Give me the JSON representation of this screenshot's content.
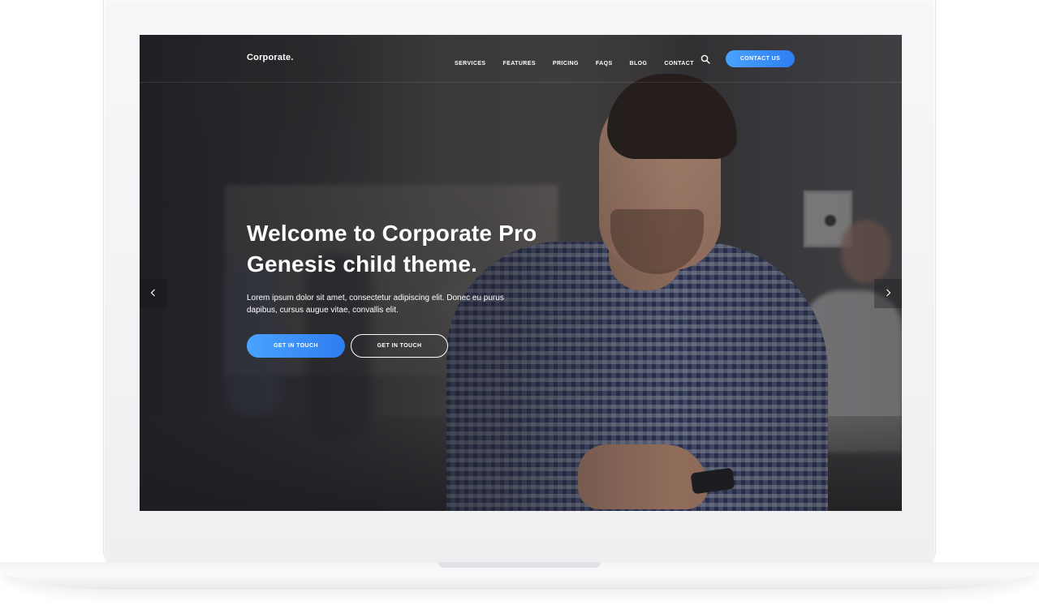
{
  "header": {
    "brand": "Corporate.",
    "nav": [
      {
        "label": "SERVICES"
      },
      {
        "label": "FEATURES"
      },
      {
        "label": "PRICING"
      },
      {
        "label": "FAQS"
      },
      {
        "label": "BLOG"
      },
      {
        "label": "CONTACT"
      }
    ],
    "search_icon": "search-icon",
    "contact_button": "CONTACT US"
  },
  "hero": {
    "title_line1": "Welcome to Corporate Pro",
    "title_line2": "Genesis child theme.",
    "text_line1": "Lorem ipsum dolor sit amet, consectetur adipiscing elit. Donec eu purus",
    "text_line2": "dapibus, cursus augue vitae, convallis elit.",
    "primary_button": "GET IN TOUCH",
    "secondary_button": "GET IN TOUCH"
  },
  "slider": {
    "prev_icon": "chevron-left-icon",
    "next_icon": "chevron-right-icon"
  },
  "colors": {
    "accent": "#3b8ff5",
    "text": "#ffffff"
  }
}
